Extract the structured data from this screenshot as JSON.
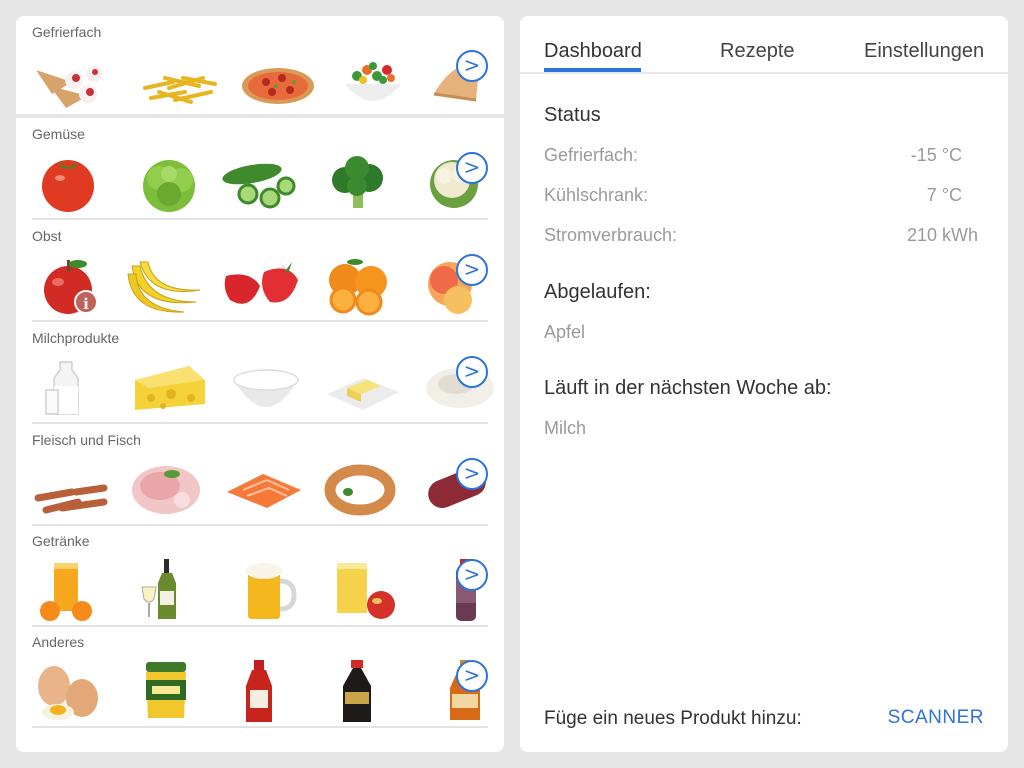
{
  "categories": [
    {
      "title": "Gefrierfach",
      "items": [
        "ice-cream-cones-icon",
        "french-fries-icon",
        "pizza-icon",
        "mixed-vegetables-icon",
        "pastry-icon"
      ]
    },
    {
      "title": "Gemüse",
      "items": [
        "tomato-icon",
        "lettuce-icon",
        "cucumber-icon",
        "broccoli-icon",
        "cauliflower-icon"
      ]
    },
    {
      "title": "Obst",
      "items": [
        "apple-icon",
        "bananas-icon",
        "strawberries-icon",
        "oranges-icon",
        "peaches-icon"
      ]
    },
    {
      "title": "Milchprodukte",
      "items": [
        "milk-icon",
        "cheese-icon",
        "yogurt-icon",
        "butter-icon",
        "cream-cheese-icon"
      ]
    },
    {
      "title": "Fleisch und Fisch",
      "items": [
        "sausages-icon",
        "ham-icon",
        "salmon-icon",
        "ring-sausage-icon",
        "salami-icon"
      ]
    },
    {
      "title": "Getränke",
      "items": [
        "orange-juice-icon",
        "white-wine-icon",
        "beer-icon",
        "apple-juice-icon",
        "bottled-drink-icon"
      ]
    },
    {
      "title": "Anderes",
      "items": [
        "eggs-icon",
        "mustard-icon",
        "ketchup-icon",
        "soy-sauce-icon",
        "syrup-icon"
      ]
    }
  ],
  "next_label": ">",
  "info_label": "i",
  "tabs": [
    "Dashboard",
    "Rezepte",
    "Einstellungen"
  ],
  "status": {
    "heading": "Status",
    "rows": [
      {
        "label": "Gefrierfach:",
        "value": "-15 °C"
      },
      {
        "label": "Kühlschrank:",
        "value": "7 °C"
      },
      {
        "label": "Stromverbrauch:",
        "value": "210 kWh"
      }
    ]
  },
  "expired": {
    "heading": "Abgelaufen:",
    "items": [
      "Apfel"
    ]
  },
  "expiring": {
    "heading": "Läuft in der nächsten Woche ab:",
    "items": [
      "Milch"
    ]
  },
  "add_product": {
    "label": "Füge ein neues Produkt hinzu:",
    "button": "SCANNER"
  },
  "colors": {
    "accent": "#2e72dc",
    "background": "#e6e6e6",
    "panel": "#ffffff",
    "muted_text": "#9a9a9a"
  }
}
